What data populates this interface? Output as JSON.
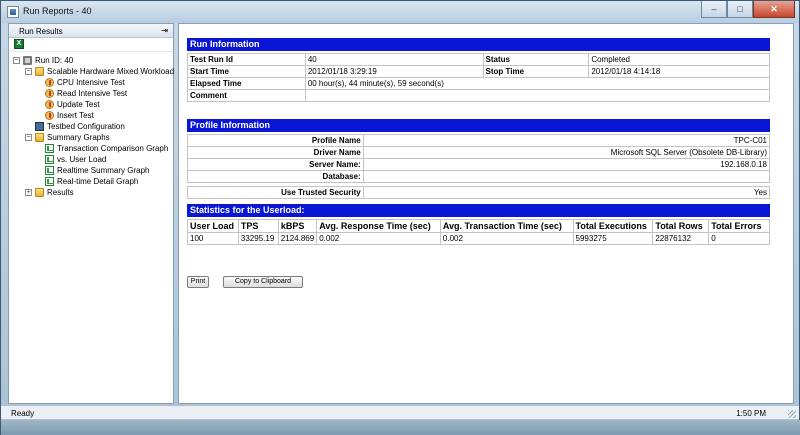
{
  "window": {
    "title": "Run Reports - 40",
    "minimize": "–",
    "maximize": "□",
    "close": "✕"
  },
  "left_panel": {
    "title": "Run Results",
    "pin": "⇥",
    "tree": [
      {
        "label": "Run ID: 40",
        "icon": "run-icon",
        "expander": "−"
      },
      {
        "label": "Scalable Hardware Mixed Workload",
        "icon": "workload-folder-icon",
        "expander": "−"
      },
      {
        "label": "CPU Intensive Test",
        "icon": "test-icon"
      },
      {
        "label": "Read Intensive Test",
        "icon": "test-icon"
      },
      {
        "label": "Update Test",
        "icon": "test-icon"
      },
      {
        "label": "Insert Test",
        "icon": "test-icon"
      },
      {
        "label": "Testbed Configuration",
        "icon": "config-icon"
      },
      {
        "label": "Summary Graphs",
        "icon": "folder-icon",
        "expander": "−"
      },
      {
        "label": "Transaction Comparison Graph",
        "icon": "graph-icon"
      },
      {
        "label": "vs. User Load",
        "icon": "graph-icon"
      },
      {
        "label": "Realtime Summary Graph",
        "icon": "graph-icon"
      },
      {
        "label": "Real-time Detail Graph",
        "icon": "graph-icon"
      },
      {
        "label": "Results",
        "icon": "folder-icon",
        "expander": "+"
      }
    ]
  },
  "run_info": {
    "header": "Run Information",
    "test_run_id_label": "Test Run Id",
    "test_run_id": "40",
    "status_label": "Status",
    "status": "Completed",
    "start_time_label": "Start Time",
    "start_time": "2012/01/18 3:29:19",
    "stop_time_label": "Stop Time",
    "stop_time": "2012/01/18 4:14:18",
    "elapsed_label": "Elapsed Time",
    "elapsed": "00 hour(s), 44 minute(s), 59 second(s)",
    "comment_label": "Comment",
    "comment": ""
  },
  "profile_info": {
    "header": "Profile Information",
    "rows": [
      {
        "label": "Profile Name",
        "value": "TPC-C01"
      },
      {
        "label": "Driver Name",
        "value": "Microsoft SQL Server (Obsolete DB-Library)"
      },
      {
        "label": "Server Name:",
        "value": "192.168.0.18"
      },
      {
        "label": "Database:",
        "value": ""
      },
      {
        "label": "Use Trusted Security",
        "value": "Yes"
      }
    ]
  },
  "stats": {
    "header": "Statistics for the Userload:",
    "columns": [
      "User Load",
      "TPS",
      "kBPS",
      "Avg. Response Time (sec)",
      "Avg. Transaction Time (sec)",
      "Total Executions",
      "Total Rows",
      "Total Errors"
    ],
    "row": [
      "100",
      "33295.19",
      "2124.869",
      "0.002",
      "0.002",
      "5993275",
      "22876132",
      "0"
    ]
  },
  "buttons": {
    "print": "Print",
    "copy": "Copy to Clipboard"
  },
  "status_bar": {
    "left": "Ready",
    "time": "1:50 PM"
  },
  "colors": {
    "section_header": "#0a16d6"
  }
}
